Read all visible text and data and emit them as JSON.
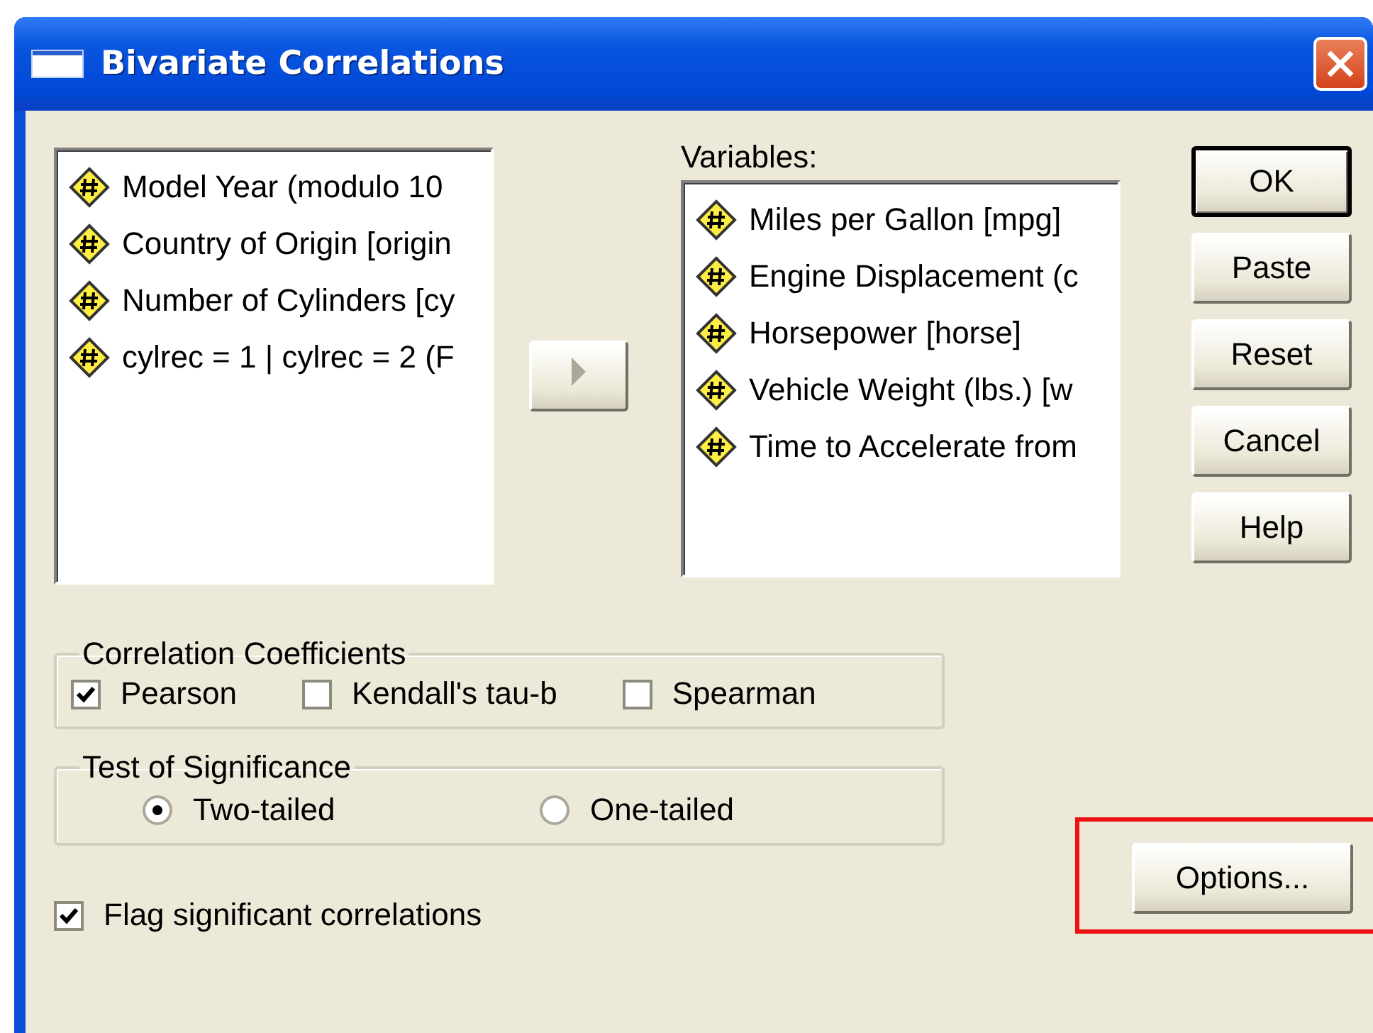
{
  "window": {
    "title": "Bivariate Correlations"
  },
  "source_list": {
    "items": [
      {
        "label": "Model Year (modulo 10"
      },
      {
        "label": "Country of Origin [origin"
      },
      {
        "label": "Number of Cylinders [cy"
      },
      {
        "label": "cylrec = 1 | cylrec = 2 (F"
      }
    ]
  },
  "move_button": {
    "disabled": true
  },
  "variables": {
    "label": "Variables:",
    "items": [
      {
        "label": "Miles per Gallon [mpg]"
      },
      {
        "label": "Engine Displacement (c"
      },
      {
        "label": "Horsepower [horse]"
      },
      {
        "label": "Vehicle Weight (lbs.) [w"
      },
      {
        "label": "Time to Accelerate from"
      }
    ]
  },
  "buttons": [
    {
      "label": "OK",
      "default": true
    },
    {
      "label": "Paste",
      "default": false
    },
    {
      "label": "Reset",
      "default": false
    },
    {
      "label": "Cancel",
      "default": false
    },
    {
      "label": "Help",
      "default": false
    }
  ],
  "correlation_coefficients": {
    "title": "Correlation Coefficients",
    "options": [
      {
        "label": "Pearson",
        "checked": true
      },
      {
        "label": "Kendall's tau-b",
        "checked": false
      },
      {
        "label": "Spearman",
        "checked": false
      }
    ]
  },
  "test_of_significance": {
    "title": "Test of Significance",
    "options": [
      {
        "label": "Two-tailed",
        "selected": true
      },
      {
        "label": "One-tailed",
        "selected": false
      }
    ]
  },
  "flag_significant": {
    "label": "Flag significant correlations",
    "checked": true
  },
  "options_button": {
    "label": "Options...",
    "highlighted": true
  }
}
